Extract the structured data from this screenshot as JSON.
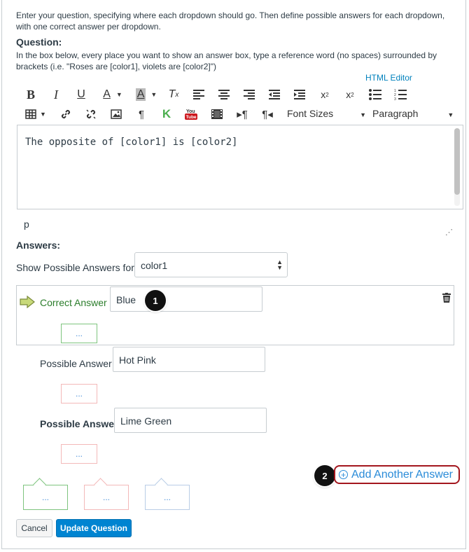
{
  "intro": "Enter your question, specifying where each dropdown should go. Then define possible answers for each dropdown, with one correct answer per dropdown.",
  "question": {
    "label": "Question:",
    "help": "In the box below, every place you want to show an answer box, type a reference word (no spaces) surrounded by brackets (i.e. \"Roses are [color1], violets are [color2]\")",
    "html_editor": "HTML Editor",
    "editor_text": "The opposite of [color1] is [color2]",
    "path": "p"
  },
  "toolbar": {
    "font_sizes": "Font Sizes",
    "paragraph": "Paragraph",
    "icons": [
      "bold-icon",
      "italic-icon",
      "underline-icon",
      "text-color-icon",
      "background-color-icon",
      "clear-formatting-icon",
      "align-left-icon",
      "align-center-icon",
      "align-right-icon",
      "outdent-icon",
      "indent-icon",
      "superscript-icon",
      "subscript-icon",
      "bullet-list-icon",
      "numbered-list-icon",
      "table-icon",
      "link-icon",
      "unlink-icon",
      "image-icon",
      "pilcrow-icon",
      "kaltura-icon",
      "youtube-icon",
      "media-icon",
      "ltr-icon",
      "rtl-icon"
    ]
  },
  "answers": {
    "label": "Answers:",
    "show_label": "Show Possible Answers for",
    "selected": "color1",
    "correct_label": "Correct Answer",
    "correct_value": "Blue",
    "possible_label": "Possible Answer",
    "possible": [
      "Hot Pink",
      "Lime Green"
    ],
    "comment_placeholder": "...",
    "add_another": "Add Another Answer"
  },
  "badges": {
    "one": "1",
    "two": "2"
  },
  "buttons": {
    "cancel": "Cancel",
    "update": "Update Question"
  },
  "colors": {
    "accent": "#0084d1",
    "correct": "#2b7d2b",
    "highlight": "#a3161e",
    "link": "#2a8bd8"
  }
}
